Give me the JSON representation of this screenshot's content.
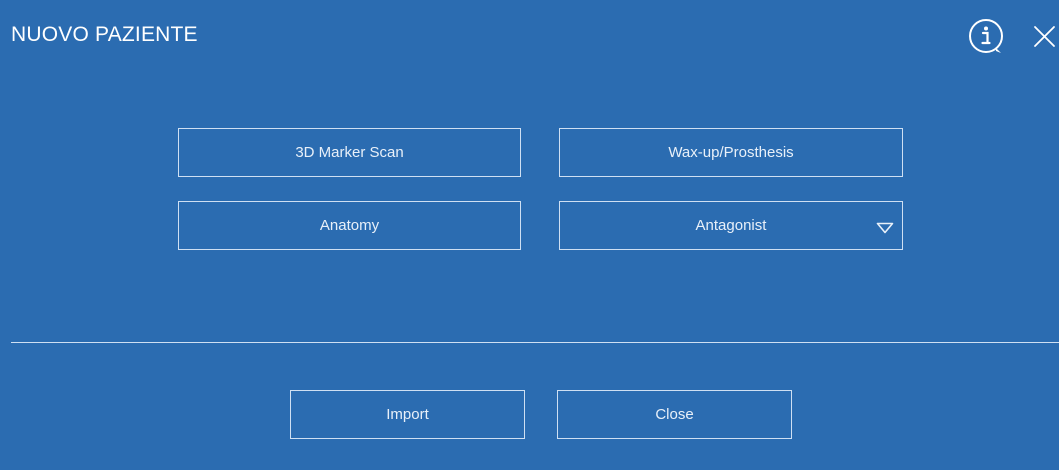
{
  "dialog": {
    "title": "NUOVO PAZIENTE",
    "background_color": "#2b6cb1",
    "header_icons": [
      "info-icon",
      "close-icon"
    ]
  },
  "scan_buttons": {
    "marker_scan_label": "3D Marker Scan",
    "waxup_label": "Wax-up/Prosthesis",
    "anatomy_label": "Anatomy",
    "antagonist_label": "Antagonist",
    "antagonist_icon": "chevron-down-icon"
  },
  "footer": {
    "import_label": "Import",
    "close_label": "Close"
  }
}
